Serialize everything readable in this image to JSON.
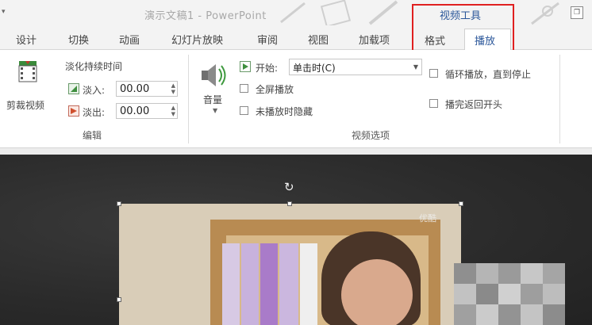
{
  "window": {
    "doc_title": "演示文稿1 - PowerPoint",
    "qat_caret": "▾",
    "restore_glyph": "❐"
  },
  "tabs": {
    "items": [
      "设计",
      "切换",
      "动画",
      "幻灯片放映",
      "审阅",
      "视图",
      "加载项"
    ],
    "context_label": "视频工具",
    "context_tabs": [
      "格式",
      "播放"
    ],
    "active_tab": "播放"
  },
  "ribbon": {
    "trim_label": "剪裁视频",
    "fade_title": "淡化持续时间",
    "fade_in_label": "淡入:",
    "fade_in_value": "00.00",
    "fade_out_label": "淡出:",
    "fade_out_value": "00.00",
    "edit_group": "编辑",
    "volume_label": "音量",
    "start_label": "开始:",
    "start_value": "单击时(C)",
    "fullscreen_label": "全屏播放",
    "hide_label": "未播放时隐藏",
    "loop_label": "循环播放，直到停止",
    "rewind_label": "播完返回开头",
    "video_options_group": "视频选项"
  },
  "video": {
    "watermark": "优酷"
  },
  "colors": {
    "accent": "#2b579a",
    "highlight": "#e02020",
    "board": "#2a2a2a"
  }
}
